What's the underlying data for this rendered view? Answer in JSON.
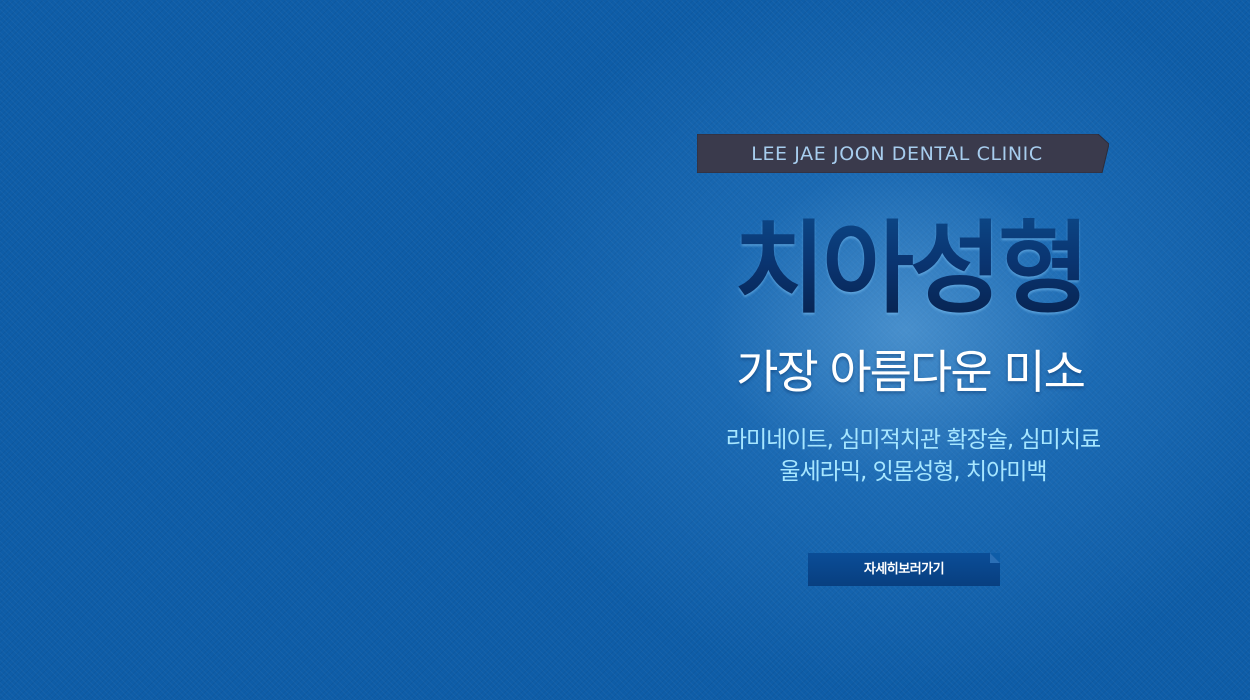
{
  "banner": {
    "ribbon_text": "LEE JAE JOON DENTAL CLINIC",
    "headline": "치아성형",
    "subheadline": "가장 아름다운  미소",
    "services": [
      "라미네이트, 심미적치관 확장술, 심미치료",
      "울세라믹, 잇몸성형, 치아미백"
    ],
    "button_label": "자세히보러가기"
  },
  "colors": {
    "background": "#0e5da8",
    "ribbon": "#3a3a4c",
    "ribbon_text": "#a7cdee",
    "headline": "#0a3470",
    "subheadline": "#ffffff",
    "services_text": "#a6e6ff",
    "button": "#0a4d97"
  }
}
